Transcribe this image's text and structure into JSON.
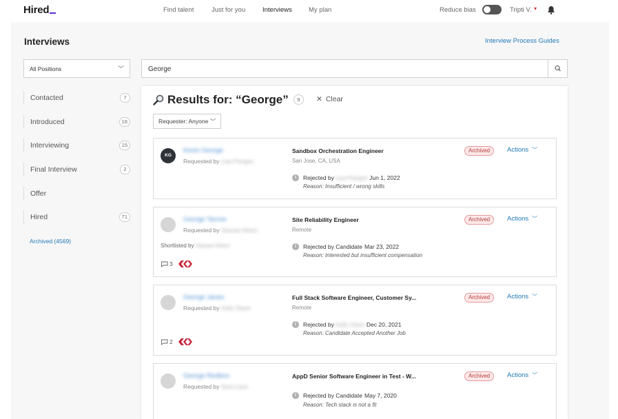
{
  "brand": {
    "logo": "Hired",
    "accent": "#5b2bd6"
  },
  "nav": {
    "links": [
      "Find talent",
      "Just for you",
      "Interviews",
      "My plan"
    ],
    "active": "Interviews",
    "reduce_bias_label": "Reduce bias",
    "reduce_bias_on": false,
    "user": "Tripti V."
  },
  "page": {
    "title": "Interviews",
    "guides_link": "Interview Process Guides",
    "position_filter": "All Positions",
    "search_value": "George"
  },
  "sidebar": {
    "items": [
      {
        "label": "Contacted",
        "count": "7"
      },
      {
        "label": "Introduced",
        "count": "16"
      },
      {
        "label": "Interviewing",
        "count": "15"
      },
      {
        "label": "Final Interview",
        "count": "2"
      },
      {
        "label": "Offer",
        "count": ""
      },
      {
        "label": "Hired",
        "count": "71"
      }
    ],
    "archived_link": "Archived (4569)"
  },
  "results": {
    "title": "Results for: “George”",
    "count": "9",
    "clear_label": "Clear",
    "requester_filter": "Requester: Anyone",
    "candidates": [
      {
        "initials": "KG",
        "name": "Kevin George",
        "requested_label": "Requested by",
        "requested_by": "Lisa Pangan",
        "job": "Sandbox Orchestration Engineer",
        "location": "San Jose, CA, USA",
        "rejected_label": "Rejected by",
        "rejected_by": "Lisa Pangan",
        "date": "Jun 1, 2022",
        "reason": "Reason: Insufficient / wrong skills",
        "status": "Archived",
        "actions": "Actions"
      },
      {
        "initials": "",
        "name": "George Tanner",
        "requested_label": "Requested by",
        "requested_by": "Hassan Ahern",
        "shortlisted_label": "Shortlisted by",
        "shortlisted_by": "Hassan Ahern",
        "notes_count": "3",
        "job": "Site Reliability Engineer",
        "location": "Remote",
        "rejected_label": "Rejected by Candidate",
        "rejected_by": "",
        "date": "Mar 23, 2022",
        "reason": "Reason: Interested but insufficient compensation",
        "status": "Archived",
        "actions": "Actions"
      },
      {
        "initials": "",
        "name": "George Janes",
        "requested_label": "Requested by",
        "requested_by": "Kelly Olsen",
        "notes_count": "2",
        "job": "Full Stack Software Engineer, Customer Sy...",
        "location": "Remote",
        "rejected_label": "Rejected by",
        "rejected_by": "Kelly Olsen",
        "date": "Dec 20, 2021",
        "reason": "Reason: Candidate Accepted Another Job",
        "status": "Archived",
        "actions": "Actions"
      },
      {
        "initials": "",
        "name": "George Redbox",
        "requested_label": "Requested by",
        "requested_by": "Sara Lane",
        "job": "AppD Senior Software Engineer in Test - W...",
        "location": "",
        "rejected_label": "Rejected by Candidate",
        "rejected_by": "",
        "date": "May 7, 2020",
        "reason": "Reason: Tech stack is not a fit",
        "status": "Archived",
        "actions": "Actions"
      }
    ]
  }
}
